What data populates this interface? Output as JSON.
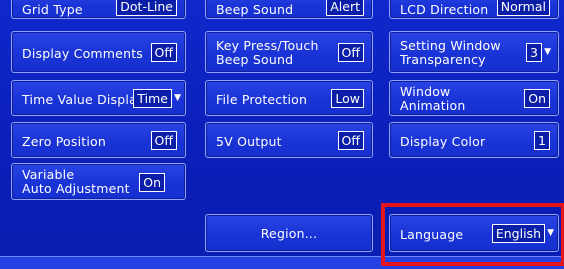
{
  "rows": {
    "row0": {
      "c1": {
        "label": "Grid Type",
        "value": "Dot-Line"
      },
      "c2": {
        "label": "Beep Sound",
        "value": "Alert"
      },
      "c3": {
        "label": "LCD Direction",
        "value": "Normal"
      }
    },
    "row1": {
      "c1": {
        "label": "Display Comments",
        "value": "Off"
      },
      "c2": {
        "label1": "Key Press/Touch",
        "label2": "Beep Sound",
        "value": "Off"
      },
      "c3": {
        "label1": "Setting Window",
        "label2": "Transparency",
        "value": "3"
      }
    },
    "row2": {
      "c1": {
        "label": "Time Value Display",
        "value": "Time"
      },
      "c2": {
        "label": "File Protection",
        "value": "Low"
      },
      "c3": {
        "label1": "Window",
        "label2": "Animation",
        "value": "On"
      }
    },
    "row3": {
      "c1": {
        "label": "Zero Position",
        "value": "Off"
      },
      "c2": {
        "label": "5V Output",
        "value": "Off"
      },
      "c3": {
        "label": "Display Color",
        "value": "1"
      }
    },
    "row4": {
      "c1": {
        "label1": "Variable",
        "label2": "Auto Adjustment",
        "value": "On"
      }
    }
  },
  "region_button": "Region...",
  "language": {
    "label": "Language",
    "value": "English"
  },
  "icons": {
    "dropdown": "triangle-down-icon"
  },
  "colors": {
    "background": "#0b1fc4",
    "card": "#1a33d6",
    "highlight": "#e8141c"
  }
}
